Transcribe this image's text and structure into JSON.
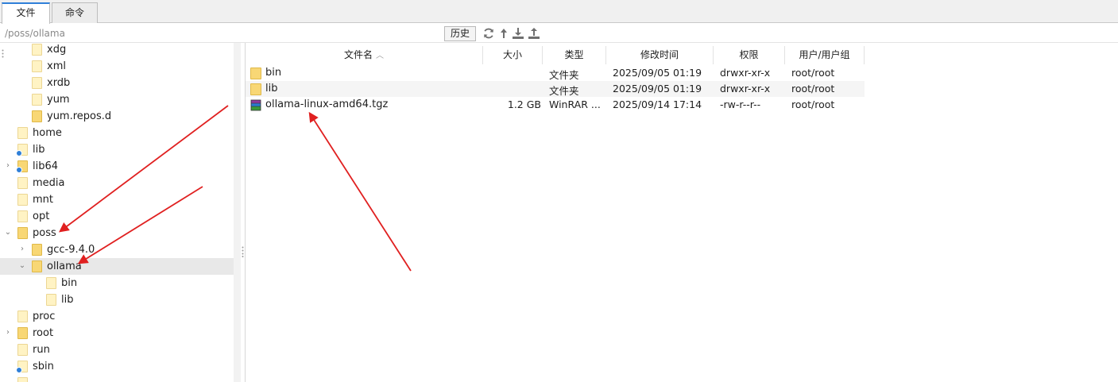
{
  "tabs": [
    {
      "label": "文件"
    },
    {
      "label": "命令"
    }
  ],
  "pathbar": {
    "path": "/poss/ollama",
    "history_label": "历史"
  },
  "toolbar_icons": [
    "refresh-icon",
    "up-icon",
    "download-icon",
    "upload-icon"
  ],
  "tree": {
    "items": [
      {
        "label": "xdg"
      },
      {
        "label": "xml"
      },
      {
        "label": "xrdb"
      },
      {
        "label": "yum"
      },
      {
        "label": "yum.repos.d"
      },
      {
        "label": "home"
      },
      {
        "label": "lib"
      },
      {
        "label": "lib64"
      },
      {
        "label": "media"
      },
      {
        "label": "mnt"
      },
      {
        "label": "opt"
      },
      {
        "label": "poss"
      },
      {
        "label": "gcc-9.4.0"
      },
      {
        "label": "ollama"
      },
      {
        "label": "bin"
      },
      {
        "label": "lib"
      },
      {
        "label": "proc"
      },
      {
        "label": "root"
      },
      {
        "label": "run"
      },
      {
        "label": "sbin"
      }
    ]
  },
  "filelist": {
    "columns": [
      "文件名",
      "大小",
      "类型",
      "修改时间",
      "权限",
      "用户/用户组"
    ],
    "rows": [
      {
        "name": "bin",
        "size": "",
        "type": "文件夹",
        "modified": "2025/09/05 01:19",
        "perms": "drwxr-xr-x",
        "owner": "root/root"
      },
      {
        "name": "lib",
        "size": "",
        "type": "文件夹",
        "modified": "2025/09/05 01:19",
        "perms": "drwxr-xr-x",
        "owner": "root/root"
      },
      {
        "name": "ollama-linux-amd64.tgz",
        "size": "1.2 GB",
        "type": "WinRAR ...",
        "modified": "2025/09/14 17:14",
        "perms": "-rw-r--r--",
        "owner": "root/root"
      }
    ]
  },
  "colors": {
    "folder": "#f8d775",
    "folder_edge": "#e0b948",
    "accent": "#2f7fd8",
    "annotation": "#e02020"
  }
}
